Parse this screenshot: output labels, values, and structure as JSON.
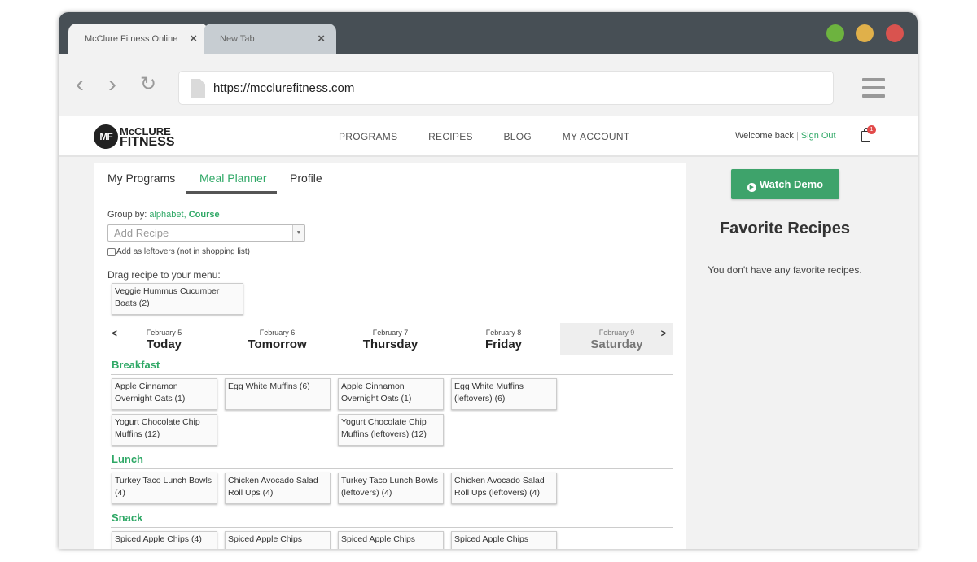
{
  "browser": {
    "tabs": [
      {
        "title": "McClure Fitness Online",
        "close": "×"
      },
      {
        "title": "New Tab",
        "close": "×"
      }
    ],
    "url": "https://mcclurefitness.com",
    "traffic_lights": [
      "#6db33f",
      "#e0b04a",
      "#d9534f"
    ]
  },
  "site": {
    "logo": {
      "mark": "MF",
      "line1": "McCLURE",
      "line2": "FITNESS"
    },
    "nav": [
      "PROGRAMS",
      "RECIPES",
      "BLOG",
      "MY ACCOUNT"
    ],
    "welcome": "Welcome back",
    "separator": "|",
    "sign_out": "Sign Out",
    "cart_count": "1",
    "accent": "#2fa866"
  },
  "planner": {
    "tabs": [
      "My Programs",
      "Meal Planner",
      "Profile"
    ],
    "group_by_label": "Group by:",
    "group_by_alpha": "alphabet",
    "group_by_comma": ",",
    "group_by_course": "Course",
    "add_recipe_placeholder": "Add Recipe",
    "leftovers_label": "Add as leftovers (not in shopping list)",
    "drag_label": "Drag recipe to your menu:",
    "drag_card": "Veggie Hummus Cucumber Boats (2)",
    "days": [
      {
        "date": "February 5",
        "name": "Today"
      },
      {
        "date": "February 6",
        "name": "Tomorrow"
      },
      {
        "date": "February 7",
        "name": "Thursday"
      },
      {
        "date": "February 8",
        "name": "Friday"
      },
      {
        "date": "February 9",
        "name": "Saturday"
      }
    ],
    "sections": [
      {
        "title": "Breakfast",
        "rows": [
          [
            "Apple Cinnamon Overnight Oats (1)",
            "Egg White Muffins (6)",
            "Apple Cinnamon Overnight Oats (1)",
            "Egg White Muffins (leftovers) (6)"
          ],
          [
            "Yogurt Chocolate Chip Muffins (12)",
            "",
            "Yogurt Chocolate Chip Muffins (leftovers) (12)",
            ""
          ]
        ]
      },
      {
        "title": "Lunch",
        "rows": [
          [
            "Turkey Taco Lunch Bowls (4)",
            "Chicken Avocado Salad Roll Ups (4)",
            "Turkey Taco Lunch Bowls (leftovers) (4)",
            "Chicken Avocado Salad Roll Ups (leftovers) (4)"
          ]
        ]
      },
      {
        "title": "Snack",
        "rows": [
          [
            "Spiced Apple Chips (4)",
            "Spiced Apple Chips",
            "Spiced Apple Chips",
            "Spiced Apple Chips"
          ]
        ]
      }
    ]
  },
  "sidebar": {
    "watch_demo": "Watch Demo",
    "favorites_title": "Favorite Recipes",
    "favorites_empty": "You don't have any favorite recipes."
  }
}
